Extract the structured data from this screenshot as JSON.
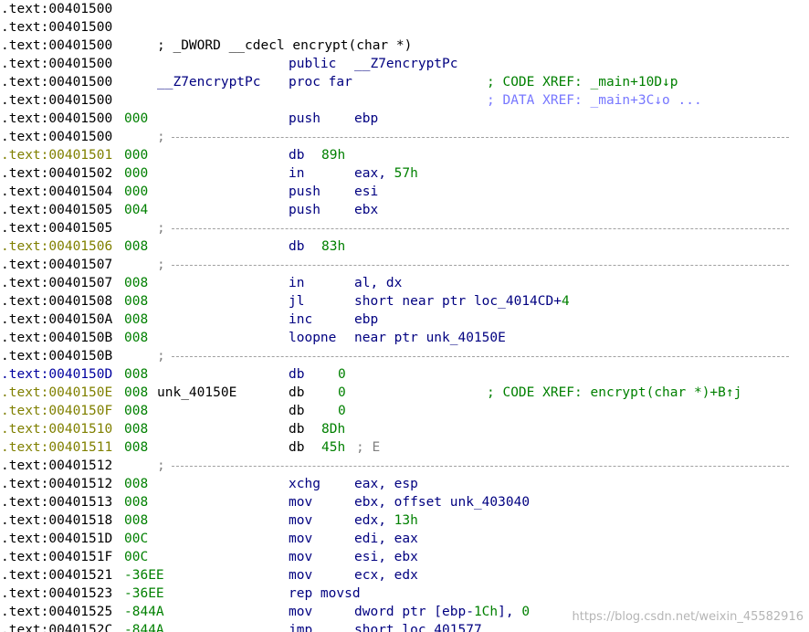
{
  "listing": {
    "lines": [
      {
        "addr": ".text:00401500"
      },
      {
        "addr": ".text:00401500"
      },
      {
        "addr": ".text:00401500",
        "comment": "; _DWORD __cdecl encrypt(char *)"
      },
      {
        "addr": ".text:00401500",
        "mnem": "public",
        "ops": "__Z7encryptPc"
      },
      {
        "addr": ".text:00401500",
        "label": "__Z7encryptPc",
        "mnem": "proc far",
        "xref": "; CODE XREF: _main+10D↓p"
      },
      {
        "addr": ".text:00401500",
        "xref": "; DATA XREF: _main+3C↓o ...",
        "xref_kind": "data"
      },
      {
        "addr": ".text:00401500",
        "stack": "000",
        "mnem": "push",
        "ops": "ebp"
      },
      {
        "addr": ".text:00401500",
        "sep": true,
        "sep_char": ";"
      },
      {
        "addr": ".text:00401501",
        "addr_color": "olive",
        "stack": "000",
        "mnem": "db",
        "db_value": "89h"
      },
      {
        "addr": ".text:00401502",
        "stack": "000",
        "mnem": "in",
        "ops": "eax, ",
        "ops_num": "57h"
      },
      {
        "addr": ".text:00401504",
        "stack": "000",
        "mnem": "push",
        "ops": "esi"
      },
      {
        "addr": ".text:00401505",
        "stack": "004",
        "mnem": "push",
        "ops": "ebx"
      },
      {
        "addr": ".text:00401505",
        "sep": true,
        "sep_char": ";"
      },
      {
        "addr": ".text:00401506",
        "addr_color": "olive",
        "stack": "008",
        "mnem": "db",
        "db_value": "83h"
      },
      {
        "addr": ".text:00401507",
        "sep": true,
        "sep_char": ";"
      },
      {
        "addr": ".text:00401507",
        "stack": "008",
        "mnem": "in",
        "ops": "al, dx"
      },
      {
        "addr": ".text:00401508",
        "stack": "008",
        "mnem": "jl",
        "ops": "short near ptr loc_4014CD+",
        "ops_num": "4"
      },
      {
        "addr": ".text:0040150A",
        "stack": "008",
        "mnem": "inc",
        "ops": "ebp"
      },
      {
        "addr": ".text:0040150B",
        "stack": "008",
        "mnem": "loopne",
        "ops": "near ptr unk_40150E"
      },
      {
        "addr": ".text:0040150B",
        "sep": true,
        "sep_char": ";"
      },
      {
        "addr": ".text:0040150D",
        "addr_color": "blue",
        "stack": "008",
        "mnem": "db",
        "db_value": "0",
        "db_align": "c"
      },
      {
        "addr": ".text:0040150E",
        "addr_color": "olive",
        "stack": "008",
        "label": "unk_40150E",
        "label_color": "black",
        "mnem": "db",
        "mnem_color": "black",
        "db_value": "0",
        "db_align": "c",
        "xref": "; CODE XREF: encrypt(char *)+B↑j"
      },
      {
        "addr": ".text:0040150F",
        "addr_color": "olive",
        "stack": "008",
        "mnem": "db",
        "mnem_color": "black",
        "db_value": "0",
        "db_align": "c"
      },
      {
        "addr": ".text:00401510",
        "addr_color": "olive",
        "stack": "008",
        "mnem": "db",
        "mnem_color": "black",
        "db_value": "8Dh"
      },
      {
        "addr": ".text:00401511",
        "addr_color": "olive",
        "stack": "008",
        "mnem": "db",
        "mnem_color": "black",
        "db_value": "45h",
        "db_comment": "; E"
      },
      {
        "addr": ".text:00401512",
        "sep": true,
        "sep_char": ";"
      },
      {
        "addr": ".text:00401512",
        "stack": "008",
        "mnem": "xchg",
        "ops": "eax, esp"
      },
      {
        "addr": ".text:00401513",
        "stack": "008",
        "mnem": "mov",
        "ops": "ebx, offset unk_403040"
      },
      {
        "addr": ".text:00401518",
        "stack": "008",
        "mnem": "mov",
        "ops": "edx, ",
        "ops_num": "13h"
      },
      {
        "addr": ".text:0040151D",
        "stack": "00C",
        "mnem": "mov",
        "ops": "edi, eax"
      },
      {
        "addr": ".text:0040151F",
        "stack": "00C",
        "mnem": "mov",
        "ops": "esi, ebx"
      },
      {
        "addr": ".text:00401521",
        "stack": "-36EE",
        "mnem": "mov",
        "ops": "ecx, edx"
      },
      {
        "addr": ".text:00401523",
        "stack": "-36EE",
        "mnem": "rep movsd"
      },
      {
        "addr": ".text:00401525",
        "stack": "-844A",
        "mnem": "mov",
        "ops": "dword ptr [ebp-",
        "ops_num": "1Ch",
        "ops_tail": "], ",
        "ops_num2": "0"
      },
      {
        "addr": ".text:0040152C",
        "stack": "-844A",
        "mnem": "jmp",
        "ops": "short loc_401577"
      }
    ]
  },
  "colors": {
    "address": "#000000",
    "address_olive": "#808000",
    "address_blue": "#0000a0",
    "instruction": "#000080",
    "stack_and_numbers": "#008000",
    "data_xref": "#7777ff",
    "separator": "#a0a0a0"
  },
  "watermark": "https://blog.csdn.net/weixin_45582916"
}
